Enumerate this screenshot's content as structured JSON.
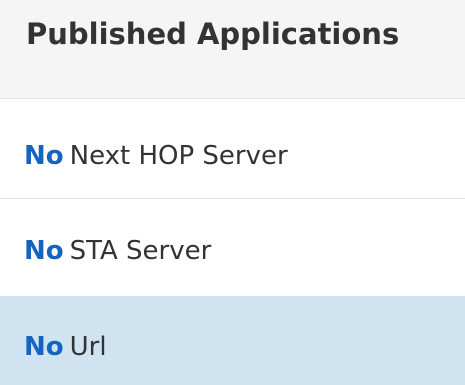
{
  "header": {
    "title": "Published Applications"
  },
  "rows": [
    {
      "status": "No",
      "label": "Next HOP Server",
      "selected": false
    },
    {
      "status": "No",
      "label": "STA Server",
      "selected": false
    },
    {
      "status": "No",
      "label": "Url",
      "selected": true
    }
  ],
  "colors": {
    "status_accent": "#1565c0",
    "selected_row_bg": "#cfe3f0",
    "header_bg": "#f5f5f5"
  }
}
